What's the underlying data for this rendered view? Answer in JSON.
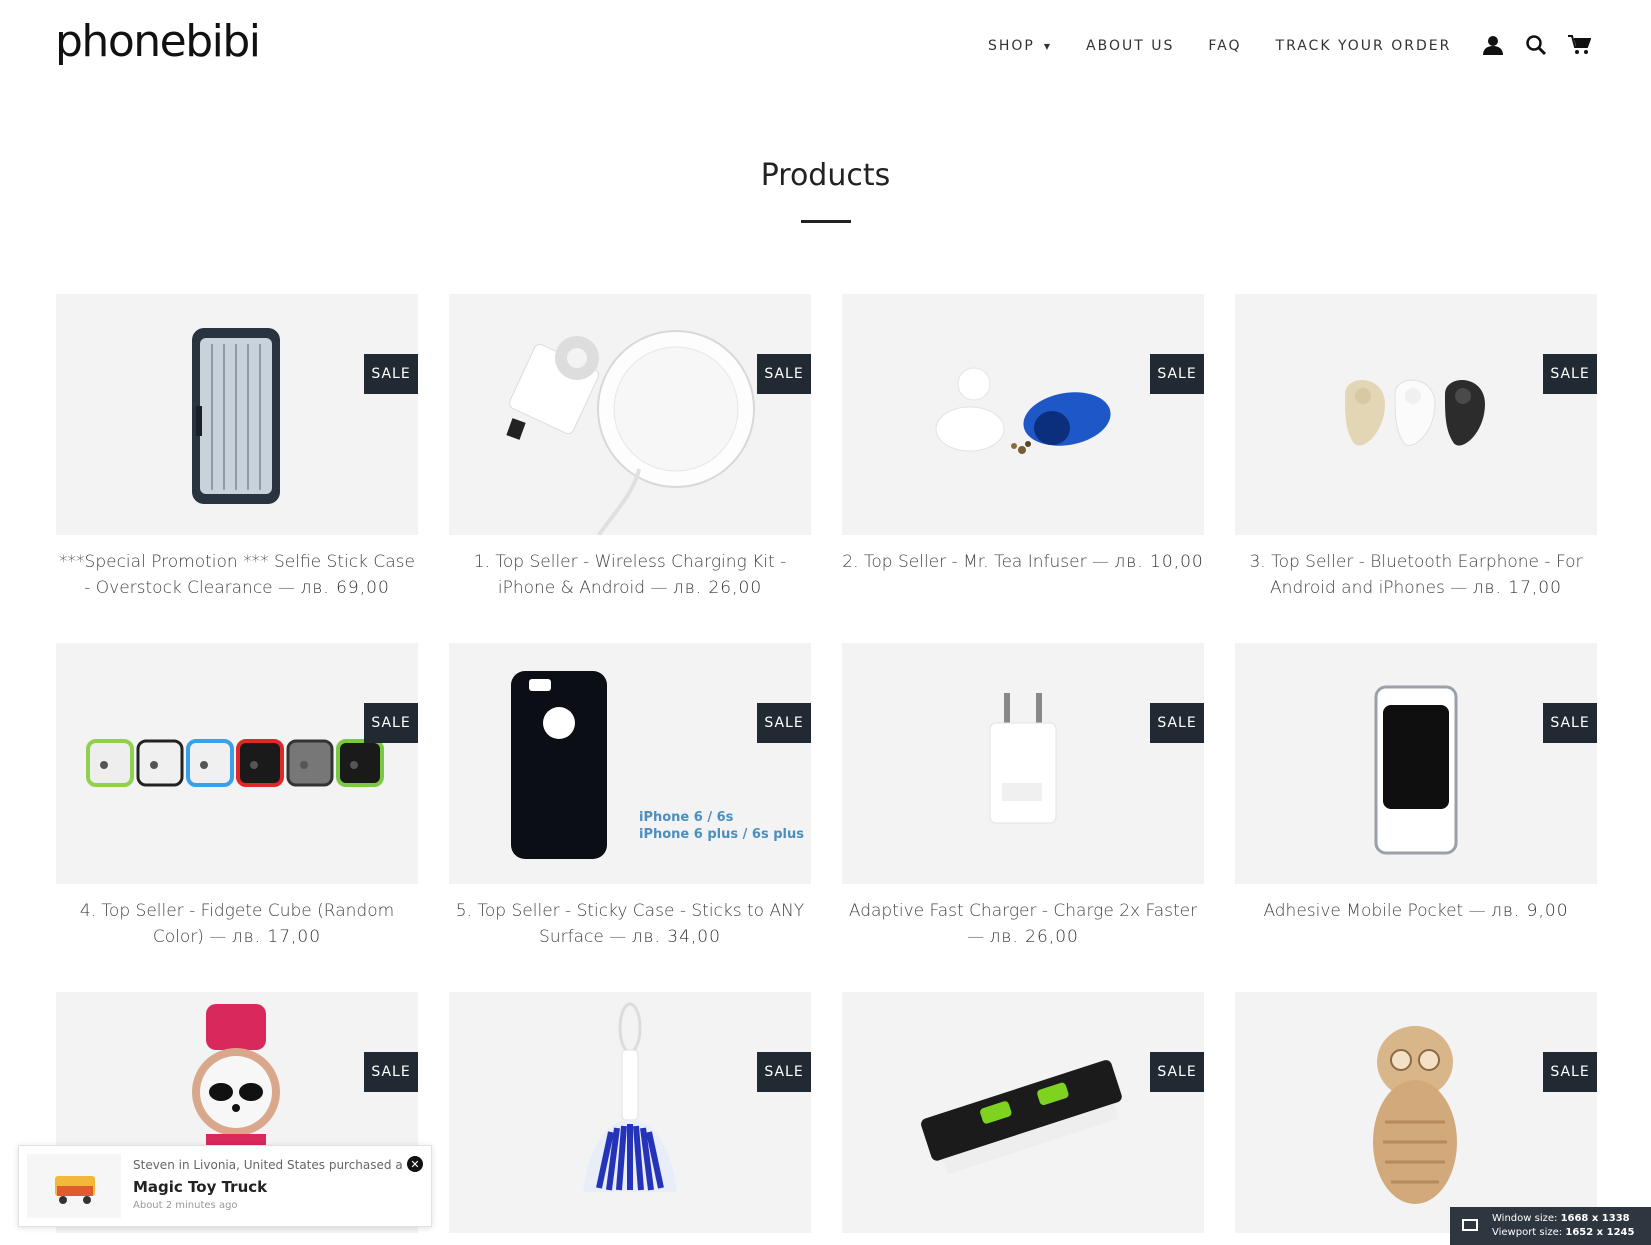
{
  "header": {
    "logo": "phonebibi",
    "nav": [
      {
        "label": "SHOP",
        "has_caret": true
      },
      {
        "label": "ABOUT US"
      },
      {
        "label": "FAQ"
      },
      {
        "label": "TRACK YOUR ORDER"
      }
    ],
    "icons": [
      "account-icon",
      "search-icon",
      "cart-icon"
    ]
  },
  "page": {
    "title": "Products"
  },
  "products": [
    {
      "name": "***Special Promotion *** Selfie Stick Case - Overstock Clearance",
      "price": "лв. 69,00",
      "badge": "SALE",
      "image": "selfie-case"
    },
    {
      "name": "1. Top Seller - Wireless Charging Kit - iPhone & Android",
      "price": "лв. 26,00",
      "badge": "SALE",
      "image": "wireless-charger"
    },
    {
      "name": "2. Top Seller - Mr. Tea Infuser",
      "price": "лв. 10,00",
      "badge": "SALE",
      "image": "tea-infuser"
    },
    {
      "name": "3. Top Seller - Bluetooth Earphone - For Android and iPhones",
      "price": "лв. 17,00",
      "badge": "SALE",
      "image": "earphones"
    },
    {
      "name": "4. Top Seller - Fidgete Cube (Random Color)",
      "price": "лв. 17,00",
      "badge": "SALE",
      "image": "fidget-cubes"
    },
    {
      "name": "5. Top Seller - Sticky Case - Sticks to ANY Surface",
      "price": "лв. 34,00",
      "badge": "SALE",
      "image": "sticky-case",
      "image_text": [
        "iPhone 6 / 6s",
        "iPhone 6 plus / 6s plus"
      ]
    },
    {
      "name": "Adaptive Fast Charger - Charge 2x Faster",
      "price": "лв. 26,00",
      "badge": "SALE",
      "image": "fast-charger"
    },
    {
      "name": "Adhesive Mobile Pocket",
      "price": "лв. 9,00",
      "badge": "SALE",
      "image": "mobile-pocket"
    },
    {
      "name": "",
      "price": "",
      "badge": "SALE",
      "image": "panda-watch"
    },
    {
      "name": "",
      "price": "",
      "badge": "SALE",
      "image": "brush"
    },
    {
      "name": "",
      "price": "",
      "badge": "SALE",
      "image": "laser-level"
    },
    {
      "name": "",
      "price": "",
      "badge": "SALE",
      "image": "wooden-owl"
    }
  ],
  "popup": {
    "line1": "Steven in Livonia, United States purchased a",
    "product": "Magic Toy Truck",
    "time": "About 2 minutes ago",
    "close_icon": "close-icon"
  },
  "window_info": {
    "window_label": "Window size:",
    "window_value": "1668 x 1338",
    "viewport_label": "Viewport size:",
    "viewport_value": "1652 x 1245"
  },
  "colors": {
    "sale_badge": "#212a33",
    "thumb_bg": "#f3f3f3",
    "text": "#444444"
  }
}
